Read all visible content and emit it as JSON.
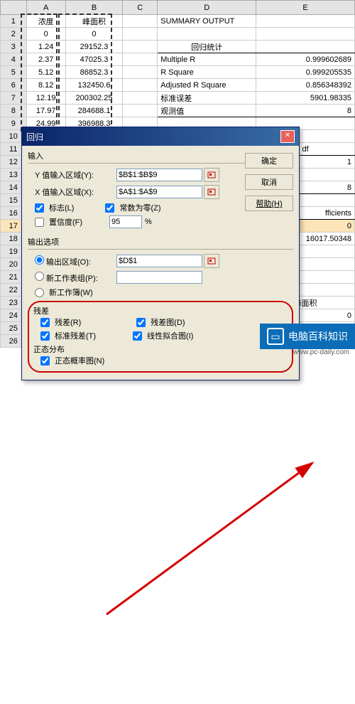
{
  "spreadsheet": {
    "columns": [
      "A",
      "B",
      "C",
      "D",
      "E"
    ],
    "rows": [
      {
        "A": "浓度",
        "B": "峰面积",
        "C": "",
        "D": "SUMMARY OUTPUT",
        "E": ""
      },
      {
        "A": "0",
        "B": "0",
        "C": "",
        "D": "",
        "E": ""
      },
      {
        "A": "1.24",
        "B": "29152.3",
        "C": "",
        "D": "回归统计",
        "E": ""
      },
      {
        "A": "2.37",
        "B": "47025.3",
        "C": "",
        "D": "Multiple R",
        "E": "0.999602689"
      },
      {
        "A": "5.12",
        "B": "86852.3",
        "C": "",
        "D": "R Square",
        "E": "0.999205535"
      },
      {
        "A": "8.12",
        "B": "132450.6",
        "C": "",
        "D": "Adjusted R Square",
        "E": "0.856348392"
      },
      {
        "A": "12.19",
        "B": "200302.25",
        "C": "",
        "D": "标准误差",
        "E": "5901.98335"
      },
      {
        "A": "17.97",
        "B": "284688.1",
        "C": "",
        "D": "观测值",
        "E": "8"
      },
      {
        "A": "24.99",
        "B": "396988.3",
        "C": "",
        "D": "",
        "E": ""
      },
      {
        "A": "",
        "B": "",
        "C": "",
        "D": "",
        "E": ""
      }
    ],
    "df_label": "df",
    "right_vals": [
      "1",
      "8",
      "",
      "",
      "fficients",
      "0",
      "16017.50348",
      "",
      "",
      "",
      "",
      "峰面积",
      "0"
    ]
  },
  "dialog": {
    "title": "回归",
    "input_section": "输入",
    "y_label": "Y 值输入区域(Y):",
    "y_value": "$B$1:$B$9",
    "x_label": "X 值输入区域(X):",
    "x_value": "$A$1:$A$9",
    "flag_label": "标志(L)",
    "const_zero_label": "常数为零(Z)",
    "confidence_label": "置信度(F)",
    "confidence_val": "95",
    "confidence_pct": "%",
    "output_section": "输出选项",
    "output_area_label": "输出区域(O):",
    "output_area_val": "$D$1",
    "new_worksheet_label": "新工作表组(P):",
    "new_workbook_label": "新工作簿(W)",
    "residual_section": "残差",
    "resid_label": "残差(R)",
    "std_resid_label": "标准残差(T)",
    "resid_plot_label": "残差图(D)",
    "line_fit_label": "线性拟合图(I)",
    "normal_section": "正态分布",
    "normal_prob_label": "正态概率图(N)",
    "ok_btn": "确定",
    "cancel_btn": "取消",
    "help_btn": "帮助(H)"
  },
  "banner": {
    "text": "电脑百科知识",
    "url": "www.pc-daily.com"
  }
}
